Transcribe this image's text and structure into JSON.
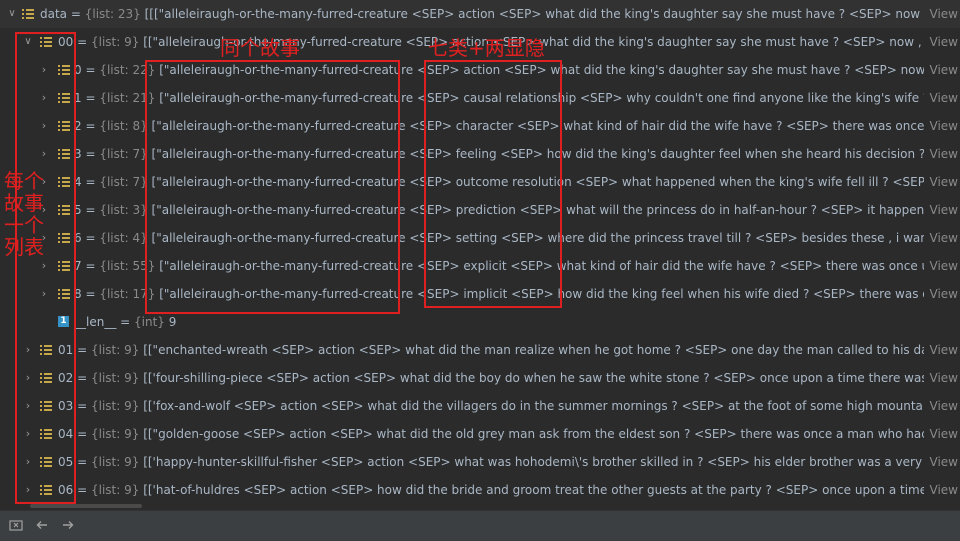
{
  "rows": [
    {
      "key": "data",
      "type": "{list: 23}",
      "val": "[[[\"alleleiraugh-or-the-many-furred-creature <SEP> action <SEP> what did the king's daughter say she must have ? <SEP> now , the king's daughter"
    },
    {
      "key": "00",
      "type": "{list: 9}",
      "val": "[[\"alleleiraugh-or-the-many-furred-creature <SEP> action <SEP> what did the king's daughter say she must have ? <SEP> now , the king's daughter"
    },
    {
      "key": "0",
      "type": "{list: 22}",
      "val": "[\"alleleiraugh-or-the-many-furred-creature <SEP> action <SEP> what did the king's daughter say she must have ? <SEP> now , the king's daughter"
    },
    {
      "key": "1",
      "type": "{list: 21}",
      "val": "[\"alleleiraugh-or-the-many-furred-creature <SEP> causal relationship <SEP> why couldn't one find anyone like the king's wife ? <SEP> the king"
    },
    {
      "key": "2",
      "type": "{list: 8}",
      "val": "[\"alleleiraugh-or-the-many-furred-creature <SEP> character <SEP> what kind of hair did the wife have ? <SEP> there was once upon a time"
    },
    {
      "key": "3",
      "type": "{list: 7}",
      "val": "[\"alleleiraugh-or-the-many-furred-creature <SEP> feeling <SEP> how did the king's daughter feel when she heard his decision ? <SEP> she"
    },
    {
      "key": "4",
      "type": "{list: 7}",
      "val": "[\"alleleiraugh-or-the-many-furred-creature <SEP> outcome resolution <SEP> what happened when the king's wife fell ill ? <SEP> the king"
    },
    {
      "key": "5",
      "type": "{list: 3}",
      "val": "[\"alleleiraugh-or-the-many-furred-creature <SEP> prediction <SEP> what will the princess do in half-an-hour ? <SEP> it happened one day"
    },
    {
      "key": "6",
      "type": "{list: 4}",
      "val": "[\"alleleiraugh-or-the-many-furred-creature <SEP> setting <SEP> where did the princess travel till ? <SEP> besides these , i want a cloak"
    },
    {
      "key": "7",
      "type": "{list: 55}",
      "val": "[\"alleleiraugh-or-the-many-furred-creature <SEP> explicit <SEP> what kind of hair did the wife have ? <SEP> there was once upon a time"
    },
    {
      "key": "8",
      "type": "{list: 17}",
      "val": "[\"alleleiraugh-or-the-many-furred-creature <SEP> implicit <SEP> how did the king feel when his wife died ? <SEP> there was once upon a time"
    },
    {
      "key": "__len__",
      "type": "{int}",
      "val": "9"
    },
    {
      "key": "01",
      "type": "{list: 9}",
      "val": "[[\"enchanted-wreath <SEP> action <SEP> what did the man realize when he got home ? <SEP> one day the man called to his daughter"
    },
    {
      "key": "02",
      "type": "{list: 9}",
      "val": "[['four-shilling-piece <SEP> action <SEP> what did the boy do when he saw the white stone ? <SEP> once upon a time there was a poor boy"
    },
    {
      "key": "03",
      "type": "{list: 9}",
      "val": "[['fox-and-wolf <SEP> action <SEP> what did the villagers do in the summer mornings ? <SEP> at the foot of some high mountains there"
    },
    {
      "key": "04",
      "type": "{list: 9}",
      "val": "[[\"golden-goose <SEP> action <SEP> what did the old grey man ask from the eldest son ? <SEP> there was once a man who had three sons"
    },
    {
      "key": "05",
      "type": "{list: 9}",
      "val": "[['happy-hunter-skillful-fisher <SEP> action <SEP> what was hohodemi\\'s brother skilled in ? <SEP> his elder brother was a very skillful"
    },
    {
      "key": "06",
      "type": "{list: 9}",
      "val": "[['hat-of-huldres <SEP> action <SEP> how did the bride and groom treat the other guests at the party ? <SEP> once upon a time there was"
    }
  ],
  "view_label": "View",
  "annotations": {
    "same_story": "同个故事",
    "seven_types": "七类+两显隐",
    "per_story_list": [
      "每个",
      "故事",
      "一个",
      "列表"
    ]
  },
  "bottom_icons": [
    "remove-icon",
    "arrow-left-icon",
    "arrow-right-icon"
  ]
}
